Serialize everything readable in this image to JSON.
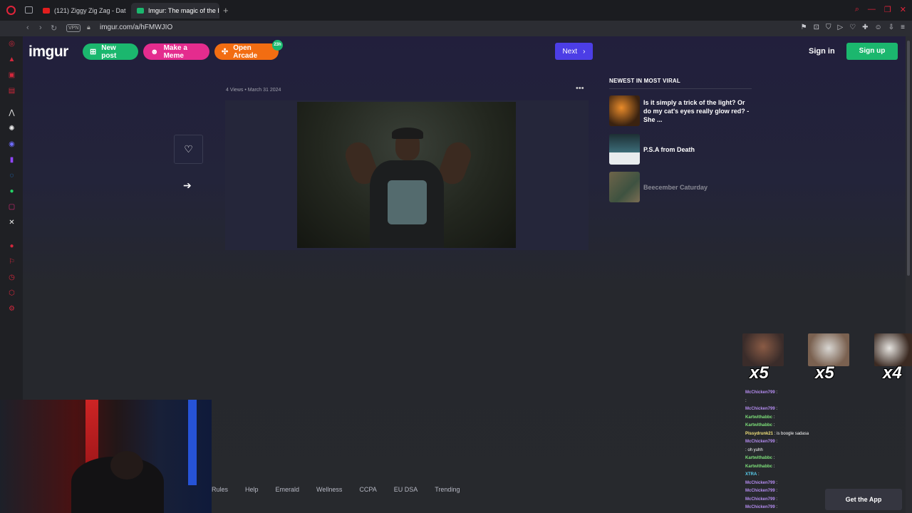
{
  "browser": {
    "tabs": [
      {
        "label": "(121) Ziggy Zig Zag - Dat"
      },
      {
        "label": "Imgur: The magic of the I"
      }
    ],
    "new_tab_symbol": "+",
    "url": "imgur.com/a/hFMWJIO",
    "vpn_label": "VPN"
  },
  "imgur": {
    "logo": "imgur",
    "new_post": "New post",
    "make_meme": "Make a Meme",
    "open_arcade": "Open Arcade",
    "arcade_badge": "23h",
    "next": "Next",
    "sign_in": "Sign in",
    "sign_up": "Sign up"
  },
  "post": {
    "views": "4 Views",
    "date": "March 31 2024",
    "more_symbol": "•••"
  },
  "viral": {
    "title": "NEWEST IN MOST VIRAL",
    "items": [
      {
        "title": "Is it simply a trick of the light? Or do my cat's eyes really glow red? - She ..."
      },
      {
        "title": "P.S.A from Death"
      },
      {
        "title": "Beecember Caturday"
      }
    ]
  },
  "footer": {
    "links": [
      "Rules",
      "Help",
      "Emerald",
      "Wellness",
      "CCPA",
      "EU DSA",
      "Trending"
    ],
    "get_app": "Get the App"
  },
  "overlay": {
    "emotes": [
      {
        "multiplier": "x5"
      },
      {
        "multiplier": "x5"
      },
      {
        "multiplier": "x4"
      }
    ],
    "chat": [
      {
        "user": "McChicken799",
        "msg": ":",
        "color": "#b48cf0"
      },
      {
        "user": "",
        "msg": ":",
        "color": "#e0243a"
      },
      {
        "user": "McChicken799",
        "msg": ":",
        "color": "#b48cf0"
      },
      {
        "user": "Kartwithabbc",
        "msg": ":",
        "color": "#7ee07a"
      },
      {
        "user": "Kartwithabbc",
        "msg": ":",
        "color": "#7ee07a"
      },
      {
        "user": "Pissydrunk21",
        "msg": ": is boogle sadasa",
        "color": "#f0e07a"
      },
      {
        "user": "McChicken799",
        "msg": ":",
        "color": "#b48cf0"
      },
      {
        "user": "",
        "msg": ": oh yuhh",
        "color": "#e0243a"
      },
      {
        "user": "Kartwithabbc",
        "msg": ":",
        "color": "#7ee07a"
      },
      {
        "user": "Kartwithabbc",
        "msg": ":",
        "color": "#7ee07a"
      },
      {
        "user": "XTRA",
        "msg": ":",
        "color": "#5ad0f0"
      },
      {
        "user": "McChicken799",
        "msg": ":",
        "color": "#b48cf0"
      },
      {
        "user": "McChicken799",
        "msg": ":",
        "color": "#b48cf0"
      },
      {
        "user": "McChicken799",
        "msg": ":",
        "color": "#b48cf0"
      },
      {
        "user": "McChicken799",
        "msg": ":",
        "color": "#b48cf0"
      }
    ]
  }
}
